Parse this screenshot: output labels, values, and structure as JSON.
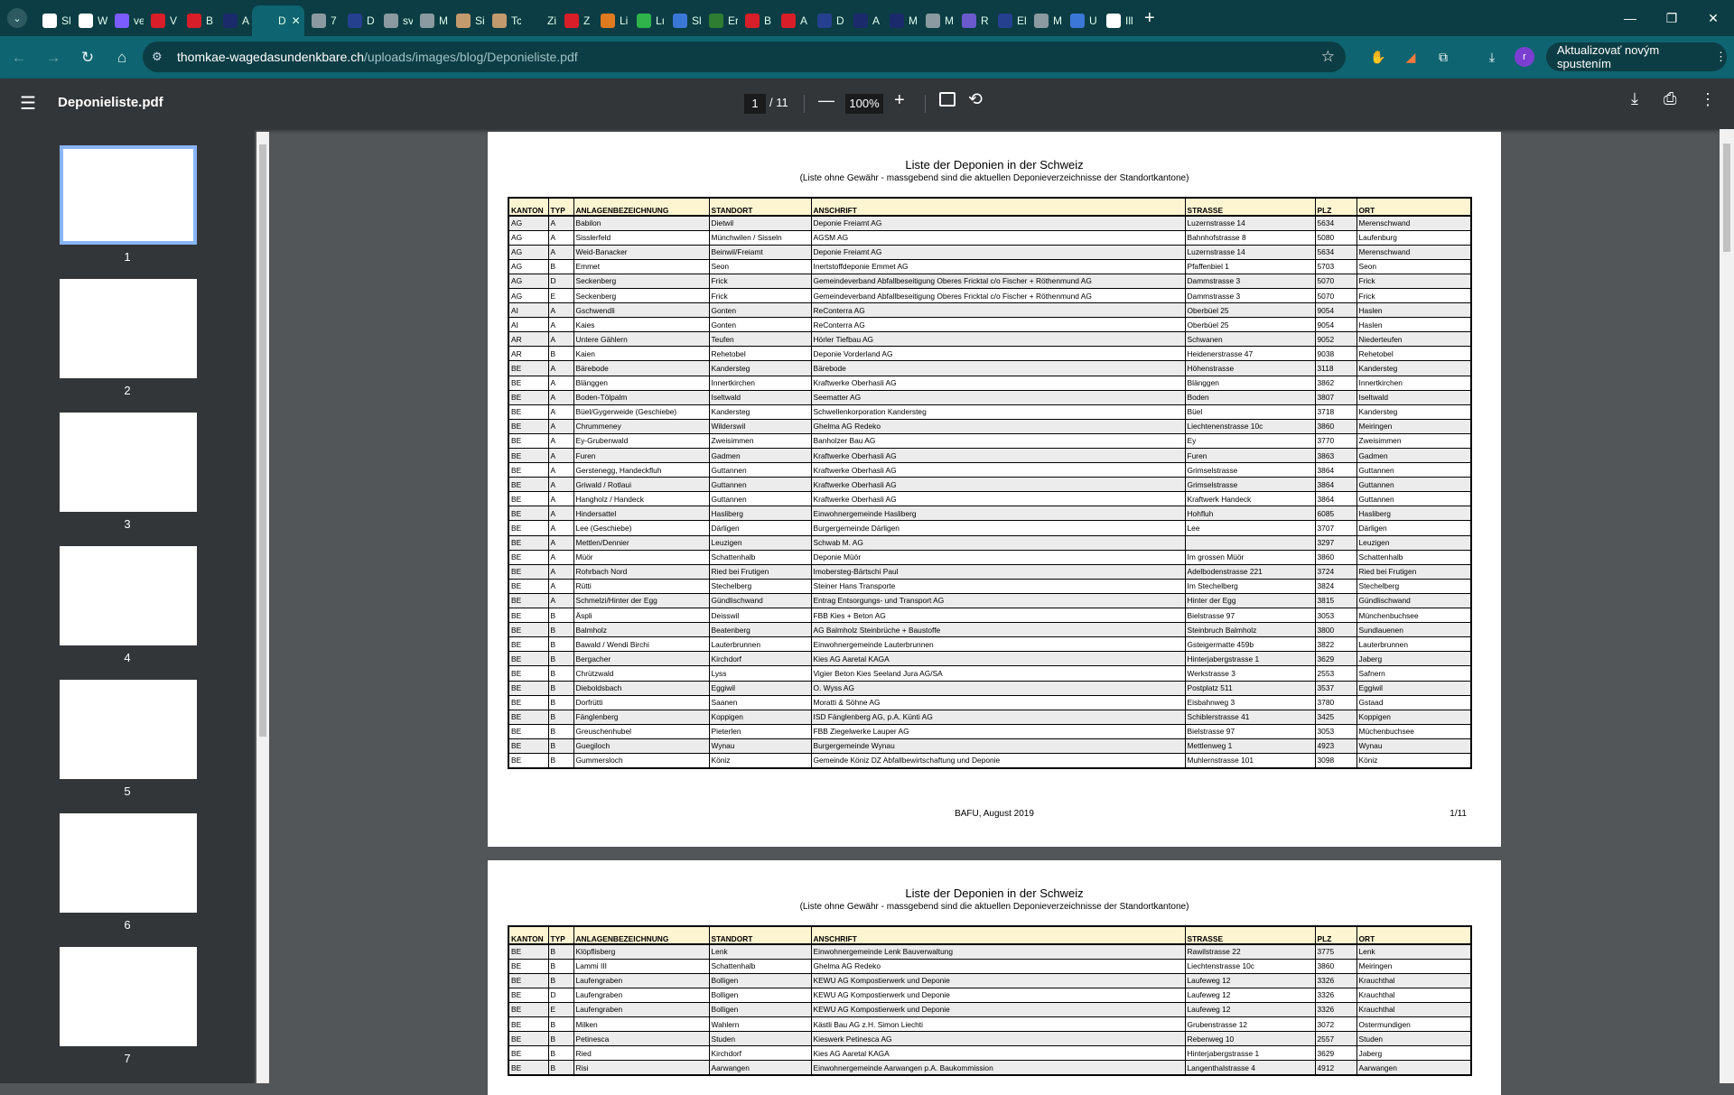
{
  "browser": {
    "tabs": [
      {
        "label": "Sl",
        "color": "#ffffff"
      },
      {
        "label": "W Vi",
        "color": "#ffffff"
      },
      {
        "label": "ve",
        "color": "#7b5cff"
      },
      {
        "label": "V",
        "color": "#d81e28"
      },
      {
        "label": "B",
        "color": "#d81e28"
      },
      {
        "label": "A",
        "color": "#1b2a6b"
      },
      {
        "label": "D",
        "color": "#0e6470",
        "active": true
      },
      {
        "label": "7",
        "color": "#8a9aa0"
      },
      {
        "label": "D",
        "color": "#24408e"
      },
      {
        "label": "sv",
        "color": "#8a9aa0"
      },
      {
        "label": "M",
        "color": "#8a9aa0"
      },
      {
        "label": "Si",
        "color": "#c29a6d"
      },
      {
        "label": "Tc",
        "color": "#c29a6d"
      },
      {
        "label": "Zi",
        "color": "#0c3d44"
      },
      {
        "label": "Z",
        "color": "#d81e28"
      },
      {
        "label": "Li",
        "color": "#e07a1f"
      },
      {
        "label": "Lı",
        "color": "#2fb34a"
      },
      {
        "label": "Sl",
        "color": "#3b77d6"
      },
      {
        "label": "Er",
        "color": "#2f7d32"
      },
      {
        "label": "B",
        "color": "#d81e28"
      },
      {
        "label": "A",
        "color": "#d81e28"
      },
      {
        "label": "D",
        "color": "#24408e"
      },
      {
        "label": "A",
        "color": "#1b2a6b"
      },
      {
        "label": "M",
        "color": "#1b2a6b"
      },
      {
        "label": "M",
        "color": "#8a9aa0"
      },
      {
        "label": "R",
        "color": "#6a5acd"
      },
      {
        "label": "El",
        "color": "#24408e"
      },
      {
        "label": "M",
        "color": "#8a9aa0"
      },
      {
        "label": "U",
        "color": "#3b77d6"
      },
      {
        "label": "Ill",
        "color": "#ffffff"
      }
    ],
    "close_tab": "✕",
    "new_tab": "+",
    "window_controls": {
      "minimize": "—",
      "restore": "❐",
      "close": "✕"
    },
    "url_domain": "thomkae-wagedasundenkbare.ch",
    "url_path": "/uploads/images/blog/Deponieliste.pdf",
    "update_button": "Aktualizovať novým spustením",
    "profile_initial": "r"
  },
  "viewer": {
    "file_name": "Deponieliste.pdf",
    "current_page": "1",
    "total_pages": "/ 11",
    "zoom": "100%",
    "thumbnails": [
      "1",
      "2",
      "3",
      "4",
      "5",
      "6",
      "7"
    ]
  },
  "document": {
    "title": "Liste der Deponien in der Schweiz",
    "subtitle": "(Liste ohne Gewähr - massgebend sind die aktuellen Deponieverzeichnisse der Standortkantone)",
    "columns": [
      "KANTON",
      "TYP",
      "ANLAGENBEZEICHNUNG",
      "STANDORT",
      "ANSCHRIFT",
      "STRASSE",
      "PLZ",
      "ORT"
    ],
    "footer": "BAFU, August 2019",
    "page_label": "1/11",
    "page1_rows": [
      [
        "AG",
        "A",
        "Babilon",
        "Dietwil",
        "Deponie Freiamt AG",
        "Luzernstrasse 14",
        "5634",
        "Merenschwand"
      ],
      [
        "AG",
        "A",
        "Sisslerfeld",
        "Münchwilen / Sisseln",
        "AGSM AG",
        "Bahnhofstrasse 8",
        "5080",
        "Laufenburg"
      ],
      [
        "AG",
        "A",
        "Weid-Banacker",
        "Beinwil/Freiamt",
        "Deponie Freiamt AG",
        "Luzernstrasse 14",
        "5634",
        "Merenschwand"
      ],
      [
        "AG",
        "B",
        "Emmet",
        "Seon",
        "Inertstoffdeponie Emmet AG",
        "Pfaffenbiel 1",
        "5703",
        "Seon"
      ],
      [
        "AG",
        "D",
        "Seckenberg",
        "Frick",
        "Gemeindeverband Abfallbeseitigung Oberes Fricktal c/o Fischer + Röthenmund AG",
        "Dammstrasse 3",
        "5070",
        "Frick"
      ],
      [
        "AG",
        "E",
        "Seckenberg",
        "Frick",
        "Gemeindeverband Abfallbeseitigung Oberes Fricktal c/o Fischer + Röthenmund AG",
        "Dammstrasse 3",
        "5070",
        "Frick"
      ],
      [
        "AI",
        "A",
        "Gschwendli",
        "Gonten",
        "ReConterra AG",
        "Oberbüel 25",
        "9054",
        "Haslen"
      ],
      [
        "AI",
        "A",
        "Kaies",
        "Gonten",
        "ReConterra AG",
        "Oberbüel 25",
        "9054",
        "Haslen"
      ],
      [
        "AR",
        "A",
        "Untere Gählern",
        "Teufen",
        "Hörler Tiefbau AG",
        "Schwanen",
        "9052",
        "Niederteufen"
      ],
      [
        "AR",
        "B",
        "Kaien",
        "Rehetobel",
        "Deponie Vorderland AG",
        "Heidenerstrasse 47",
        "9038",
        "Rehetobel"
      ],
      [
        "BE",
        "A",
        "Bärebode",
        "Kandersteg",
        "Bärebode",
        "Höhenstrasse",
        "3118",
        "Kandersteg"
      ],
      [
        "BE",
        "A",
        "Blänggen",
        "Innertkirchen",
        "Kraftwerke Oberhasli AG",
        "Blänggen",
        "3862",
        "Innertkirchen"
      ],
      [
        "BE",
        "A",
        "Boden-Tölpalm",
        "Iseltwald",
        "Seematter AG",
        "Boden",
        "3807",
        "Iseltwald"
      ],
      [
        "BE",
        "A",
        "Büel/Gygerweide (Geschiebe)",
        "Kandersteg",
        "Schwellenkorporation Kandersteg",
        "Büel",
        "3718",
        "Kandersteg"
      ],
      [
        "BE",
        "A",
        "Chrummeney",
        "Wilderswil",
        "Ghelma AG Redeko",
        "Liechtenenstrasse 10c",
        "3860",
        "Meiringen"
      ],
      [
        "BE",
        "A",
        "Ey-Grubenwald",
        "Zweisimmen",
        "Banholzer Bau AG",
        "Ey",
        "3770",
        "Zweisimmen"
      ],
      [
        "BE",
        "A",
        "Furen",
        "Gadmen",
        "Kraftwerke Oberhasli AG",
        "Furen",
        "3863",
        "Gadmen"
      ],
      [
        "BE",
        "A",
        "Gerstenegg, Handeckfluh",
        "Guttannen",
        "Kraftwerke Oberhasli AG",
        "Grimselstrasse",
        "3864",
        "Guttannen"
      ],
      [
        "BE",
        "A",
        "Griwald / Rotlaui",
        "Guttannen",
        "Kraftwerke Oberhasli AG",
        "Grimselstrasse",
        "3864",
        "Guttannen"
      ],
      [
        "BE",
        "A",
        "Hangholz / Handeck",
        "Guttannen",
        "Kraftwerke Oberhasli AG",
        "Kraftwerk Handeck",
        "3864",
        "Guttannen"
      ],
      [
        "BE",
        "A",
        "Hindersattel",
        "Hasliberg",
        "Einwohnergemeinde Hasliberg",
        "Hohfluh",
        "6085",
        "Hasliberg"
      ],
      [
        "BE",
        "A",
        "Lee (Geschiebe)",
        "Därligen",
        "Burgergemeinde Därligen",
        "Lee",
        "3707",
        "Därligen"
      ],
      [
        "BE",
        "A",
        "Mettlen/Dennier",
        "Leuzigen",
        "Schwab M.  AG",
        "",
        "3297",
        "Leuzigen"
      ],
      [
        "BE",
        "A",
        "Müör",
        "Schattenhalb",
        "Deponie Müör",
        "Im grossen Müör",
        "3860",
        "Schattenhalb"
      ],
      [
        "BE",
        "A",
        "Rohrbach Nord",
        "Ried bei Frutigen",
        "Imobersteg-Bärtschi Paul",
        "Adelbodenstrasse 221",
        "3724",
        "Ried bei Frutigen"
      ],
      [
        "BE",
        "A",
        "Rütti",
        "Stechelberg",
        "Steiner Hans Transporte",
        "Im Stechelberg",
        "3824",
        "Stechelberg"
      ],
      [
        "BE",
        "A",
        "Schmelzi/Hinter der Egg",
        "Gündlischwand",
        "Entrag Entsorgungs- und Transport AG",
        "Hinter der Egg",
        "3815",
        "Gündlischwand"
      ],
      [
        "BE",
        "B",
        "Äspli",
        "Deisswil",
        "FBB Kies +  Beton AG",
        "Bielstrasse 97",
        "3053",
        "Münchenbuchsee"
      ],
      [
        "BE",
        "B",
        "Balmholz",
        "Beatenberg",
        "AG Balmholz Steinbrüche + Baustoffe",
        "Steinbruch Balmholz",
        "3800",
        "Sundlauenen"
      ],
      [
        "BE",
        "B",
        "Bawald / Wendi Birchi",
        "Lauterbrunnen",
        "Einwohnergemeinde Lauterbrunnen",
        "Gsteigermatte 459b",
        "3822",
        "Lauterbrunnen"
      ],
      [
        "BE",
        "B",
        "Bergacher",
        "Kirchdorf",
        "Kies AG Aaretal KAGA",
        "Hinterjabergstrasse 1",
        "3629",
        "Jaberg"
      ],
      [
        "BE",
        "B",
        "Chrützwald",
        "Lyss",
        "Vigier Beton Kies Seeland Jura AG/SA",
        "Werkstrasse 3",
        "2553",
        "Safnern"
      ],
      [
        "BE",
        "B",
        "Dieboldsbach",
        "Eggiwil",
        "O. Wyss AG",
        "Postplatz 511",
        "3537",
        "Eggiwil"
      ],
      [
        "BE",
        "B",
        "Dorfrütti",
        "Saanen",
        "Moratti & Söhne AG",
        "Eisbahnweg 3",
        "3780",
        "Gstaad"
      ],
      [
        "BE",
        "B",
        "Fänglenberg",
        "Koppigen",
        "ISD Fänglenberg AG, p.A. Künti AG",
        "Schiblerstrasse 41",
        "3425",
        "Koppigen"
      ],
      [
        "BE",
        "B",
        "Greuschenhubel",
        "Pieterlen",
        "FBB Ziegelwerke Lauper AG",
        "Bielstrasse 97",
        "3053",
        "Müchenbuchsee"
      ],
      [
        "BE",
        "B",
        "Guegiloch",
        "Wynau",
        "Burgergemeinde Wynau",
        "Mettlenweg 1",
        "4923",
        "Wynau"
      ],
      [
        "BE",
        "B",
        "Gummersloch",
        "Köniz",
        "Gemeinde Köniz  DZ Abfallbewirtschaftung und Deponie",
        "Muhlernstrasse 101",
        "3098",
        "Köniz"
      ]
    ],
    "page2_rows": [
      [
        "BE",
        "B",
        "Klöpflisberg",
        "Lenk",
        "Einwohnergemeinde Lenk Bauverwaltung",
        "Rawilstrasse 22",
        "3775",
        "Lenk"
      ],
      [
        "BE",
        "B",
        "Lammi III",
        "Schattenhalb",
        "Ghelma AG Redeko",
        "Liechtenstrasse 10c",
        "3860",
        "Meiringen"
      ],
      [
        "BE",
        "B",
        "Laufengraben",
        "Bolligen",
        "KEWU AG Kompostierwerk und Deponie",
        "Laufeweg 12",
        "3326",
        "Krauchthal"
      ],
      [
        "BE",
        "D",
        "Laufengraben",
        "Bolligen",
        "KEWU AG Kompostierwerk und Deponie",
        "Laufeweg 12",
        "3326",
        "Krauchthal"
      ],
      [
        "BE",
        "E",
        "Laufengraben",
        "Bolligen",
        "KEWU AG Kompostierwerk und Deponie",
        "Laufeweg 12",
        "3326",
        "Krauchthal"
      ],
      [
        "BE",
        "B",
        "Milken",
        "Wahlern",
        "Kästli Bau AG z.H. Simon Liechti",
        "Grubenstrasse 12",
        "3072",
        "Ostermundigen"
      ],
      [
        "BE",
        "B",
        "Petinesca",
        "Studen",
        "Kieswerk Petinesca AG",
        "Rebenweg 10",
        "2557",
        "Studen"
      ],
      [
        "BE",
        "B",
        "Ried",
        "Kirchdorf",
        "Kies AG Aaretal KAGA",
        "Hinterjabergstrasse 1",
        "3629",
        "Jaberg"
      ],
      [
        "BE",
        "B",
        "Risi",
        "Aarwangen",
        "Einwohnergemeinde Aarwangen p.A. Baukommission",
        "Langenthalstrasse 4",
        "4912",
        "Aarwangen"
      ]
    ]
  }
}
